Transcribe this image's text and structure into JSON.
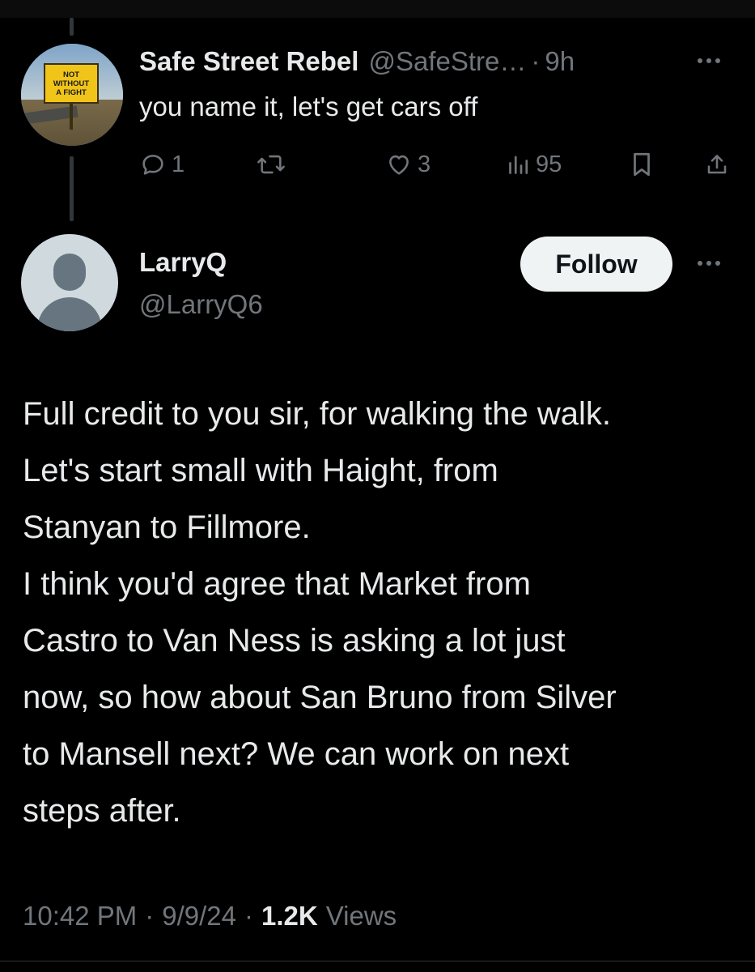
{
  "parent_tweet": {
    "avatar_sign": [
      "NOT",
      "WITHOUT",
      "A FIGHT"
    ],
    "display_name": "Safe Street Rebel",
    "handle": "@SafeStre…",
    "separator": "·",
    "time": "9h",
    "text": "you name it, let's get cars off",
    "actions": {
      "reply_count": "1",
      "retweet_count": "",
      "like_count": "3",
      "views_count": "95"
    }
  },
  "main_tweet": {
    "display_name": "LarryQ",
    "handle": "@LarryQ6",
    "follow_label": "Follow",
    "lines": [
      "Full credit to you sir, for walking the walk.",
      "Let's start small with Haight, from",
      "Stanyan to Fillmore.",
      "I think you'd agree that Market from",
      "Castro to Van Ness is asking a lot just",
      "now, so how about San Bruno from Silver",
      "to Mansell next?  We can work on next",
      "steps after."
    ],
    "meta": {
      "time": "10:42 PM",
      "date": "9/9/24",
      "separator": "·",
      "views_count": "1.2K",
      "views_label": "Views"
    }
  },
  "icons": [
    "reply-icon",
    "retweet-icon",
    "like-icon",
    "views-icon",
    "bookmark-icon",
    "share-icon",
    "more-icon"
  ],
  "colors": {
    "background": "#000000",
    "primary_text": "#e7e9ea",
    "secondary_text": "#71767b",
    "follow_bg": "#eff3f4",
    "follow_text": "#0f1419"
  }
}
